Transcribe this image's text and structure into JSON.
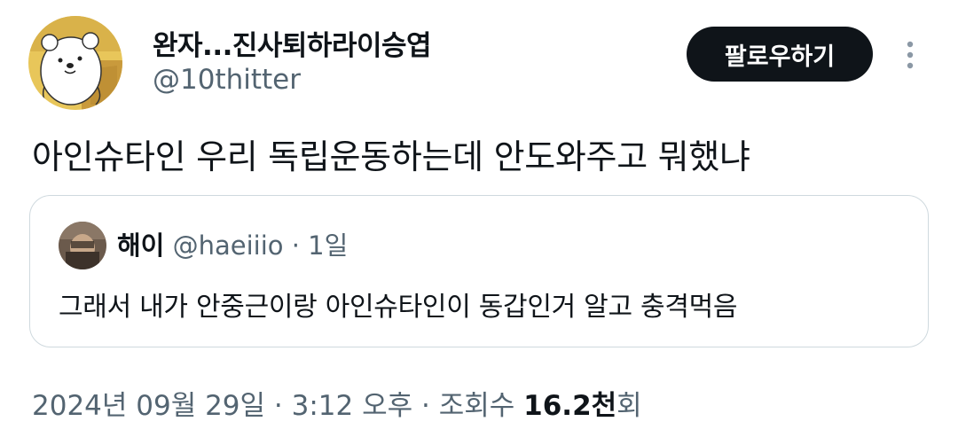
{
  "author": {
    "display_name": "완자...진사퇴하라이승엽",
    "handle": "@10thitter",
    "avatar_icon": "cartoon-bear-avatar-icon"
  },
  "actions": {
    "follow_label": "팔로우하기",
    "more_icon": "more-vertical-icon"
  },
  "tweet": {
    "text": "아인슈타인 우리 독립운동하는데 안도와주고 뭐했냐"
  },
  "quote": {
    "name": "해이",
    "handle": "@haeiiio",
    "separator": "·",
    "time": "1일",
    "text": "그래서 내가 안중근이랑 아인슈타인이 동갑인거 알고 충격먹음",
    "avatar_icon": "photo-avatar-icon"
  },
  "meta": {
    "date": "2024년 09월 29일",
    "sep1": "·",
    "time": "3:12 오후",
    "sep2": "·",
    "views_label": "조회수",
    "views_count": "16.2천",
    "views_suffix": "회"
  },
  "colors": {
    "text_primary": "#0f1419",
    "text_secondary": "#536471",
    "border": "#cfd9de",
    "button_bg": "#0f1419"
  }
}
